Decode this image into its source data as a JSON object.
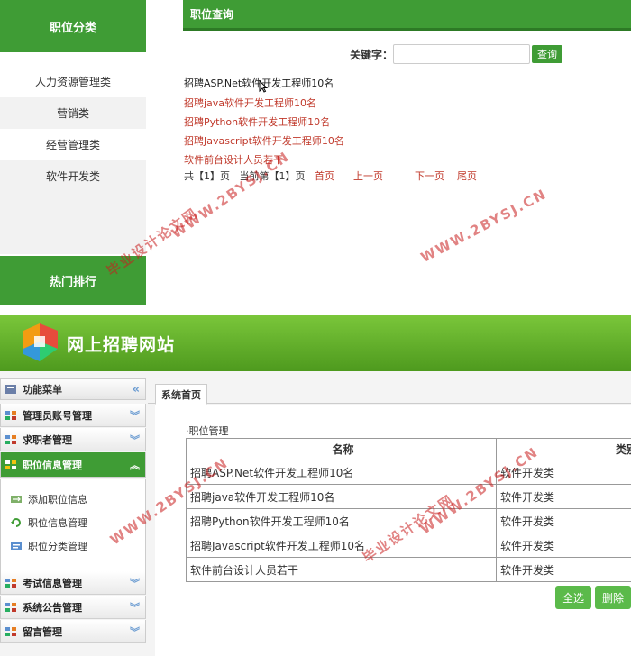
{
  "front": {
    "category_title": "职位分类",
    "categories": [
      "人力资源管理类",
      "营销类",
      "经营管理类",
      "软件开发类"
    ],
    "hot_title": "热门排行",
    "query_title": "职位查询",
    "keyword_label": "关键字：",
    "keyword_value": "",
    "search_button": "查询",
    "jobs": [
      "招聘ASP.Net软件开发工程师10名",
      "招聘java软件开发工程师10名",
      "招聘Python软件开发工程师10名",
      "招聘Javascript软件开发工程师10名",
      "软件前台设计人员若干"
    ],
    "pager": {
      "total_prefix": "共【1】页",
      "current": "当前第【1】页",
      "first": "首页",
      "prev": "上一页",
      "next": "下一页",
      "last": "尾页"
    }
  },
  "admin": {
    "site_title": "网上招聘网站",
    "menu_header": "功能菜单",
    "menu_groups_top": [
      "管理员账号管理",
      "求职者管理"
    ],
    "menu_active": "职位信息管理",
    "sub_items": [
      "添加职位信息",
      "职位信息管理",
      "职位分类管理"
    ],
    "menu_groups_bottom": [
      "考试信息管理",
      "系统公告管理",
      "留言管理"
    ],
    "tab": "系统首页",
    "section": "职位管理",
    "columns": [
      "名称",
      "类别"
    ],
    "rows": [
      [
        "招聘ASP.Net软件开发工程师10名",
        "软件开发类"
      ],
      [
        "招聘java软件开发工程师10名",
        "软件开发类"
      ],
      [
        "招聘Python软件开发工程师10名",
        "软件开发类"
      ],
      [
        "招聘Javascript软件开发工程师10名",
        "软件开发类"
      ],
      [
        "软件前台设计人员若干",
        "软件开发类"
      ]
    ],
    "select_all": "全选",
    "delete": "删除"
  },
  "watermarks": [
    "毕业设计论文网",
    "WWW.2BYSJ.CN"
  ],
  "colors": {
    "green": "#3f9c35",
    "link_red": "#c0392b",
    "banner_green": "#5fb22b"
  }
}
